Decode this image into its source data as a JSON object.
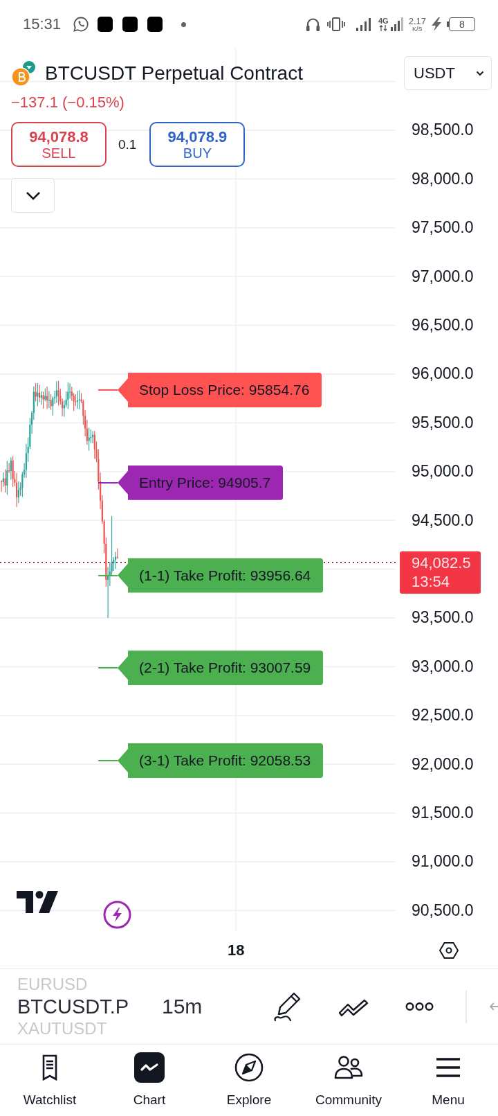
{
  "status_bar": {
    "time": "15:31",
    "network": "4G",
    "speed": "2.17",
    "speed_unit": "K/S",
    "battery": "8"
  },
  "header": {
    "title": "BTCUSDT Perpetual Contract",
    "currency": "USDT",
    "change": "−137.1 (−0.15%)"
  },
  "trade": {
    "sell_price": "94,078.8",
    "sell_label": "SELL",
    "quantity": "0.1",
    "buy_price": "94,078.9",
    "buy_label": "BUY"
  },
  "price_axis_upper": [
    "98,500.0",
    "98,000.0",
    "97,500.0",
    "97,000.0",
    "96,500.0",
    "96,000.0",
    "95,500.0",
    "95,000.0",
    "94,500.0"
  ],
  "current_price": {
    "price": "94,082.5",
    "countdown": "13:54"
  },
  "price_axis_lower": [
    "93,500.0",
    "93,000.0",
    "92,500.0",
    "92,000.0",
    "91,500.0",
    "91,000.0",
    "90,500.0"
  ],
  "orders": [
    {
      "label": "Stop Loss Price: 95854.76",
      "color": "#ff5252"
    },
    {
      "label": "Entry Price: 94905.7",
      "color": "#9c27b0"
    },
    {
      "label": "(1-1) Take Profit: 93956.64",
      "color": "#4caf50"
    },
    {
      "label": "(2-1) Take Profit: 93007.59",
      "color": "#4caf50"
    },
    {
      "label": "(3-1) Take Profit: 92058.53",
      "color": "#4caf50"
    }
  ],
  "time_axis": {
    "label": "18"
  },
  "toolbar": {
    "symbols": [
      {
        "label": "EURUSD",
        "selected": false
      },
      {
        "label": "BTCUSDT.P",
        "selected": true
      },
      {
        "label": "XAUTUSDT",
        "selected": false
      }
    ],
    "interval": "15m"
  },
  "nav": [
    {
      "label": "Watchlist",
      "selected": false
    },
    {
      "label": "Chart",
      "selected": true
    },
    {
      "label": "Explore",
      "selected": false
    },
    {
      "label": "Community",
      "selected": false
    },
    {
      "label": "Menu",
      "selected": false
    }
  ]
}
